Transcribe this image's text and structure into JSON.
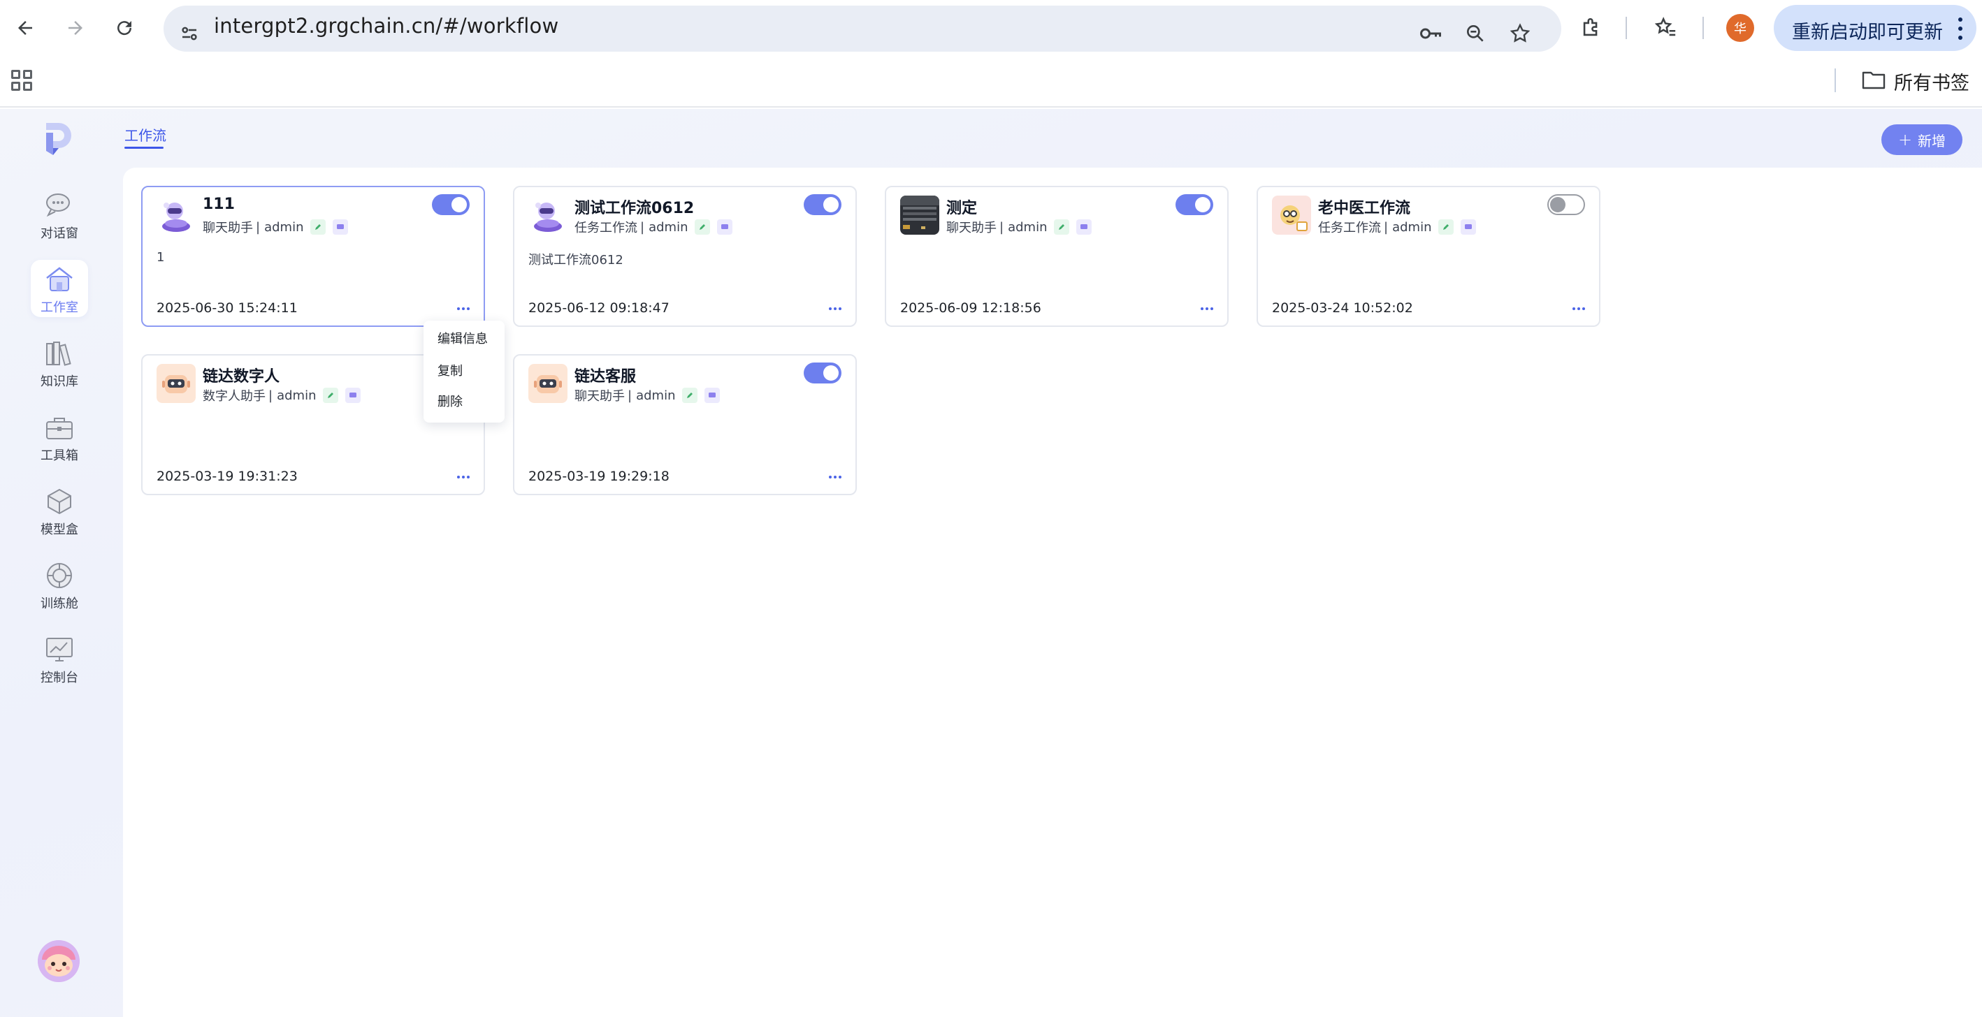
{
  "browser": {
    "url": "intergpt2.grgchain.cn/#/workflow",
    "profile_initial": "华",
    "update_button_label": "重新启动即可更新",
    "bookmarks_label": "所有书签"
  },
  "sidebar": {
    "items": [
      {
        "label": "对话窗",
        "icon": "chat-bubbles-icon"
      },
      {
        "label": "工作室",
        "icon": "house-icon",
        "active": true
      },
      {
        "label": "知识库",
        "icon": "books-icon"
      },
      {
        "label": "工具箱",
        "icon": "toolbox-icon"
      },
      {
        "label": "模型盒",
        "icon": "cube-icon"
      },
      {
        "label": "训练舱",
        "icon": "capsule-icon"
      },
      {
        "label": "控制台",
        "icon": "monitor-chart-icon"
      }
    ]
  },
  "tabs": {
    "workflow_label": "工作流"
  },
  "add_button_label": "新增",
  "cards": [
    {
      "title": "111",
      "type": "聊天助手",
      "owner": "admin",
      "description": "1",
      "date": "2025-06-30 15:24:11",
      "enabled": true,
      "avatar": "purple-bot-icon"
    },
    {
      "title": "测试工作流0612",
      "type": "任务工作流",
      "owner": "admin",
      "description": "测试工作流0612",
      "date": "2025-06-12 09:18:47",
      "enabled": true,
      "avatar": "purple-bot-icon"
    },
    {
      "title": "测定",
      "type": "聊天助手",
      "owner": "admin",
      "description": "",
      "date": "2025-06-09 12:18:56",
      "enabled": true,
      "avatar": "photo-thumbnail"
    },
    {
      "title": "老中医工作流",
      "type": "任务工作流",
      "owner": "admin",
      "description": "",
      "date": "2025-03-24 10:52:02",
      "enabled": false,
      "avatar": "doctor-icon"
    },
    {
      "title": "链达数字人",
      "type": "数字人助手",
      "owner": "admin",
      "description": "",
      "date": "2025-03-19 19:31:23",
      "enabled": null,
      "avatar": "robot-face-icon"
    },
    {
      "title": "链达客服",
      "type": "聊天助手",
      "owner": "admin",
      "description": "",
      "date": "2025-03-19 19:29:18",
      "enabled": true,
      "avatar": "robot-face-icon"
    }
  ],
  "context_menu": {
    "edit_label": "编辑信息",
    "copy_label": "复制",
    "delete_label": "删除"
  },
  "colors": {
    "accent": "#6d7fee",
    "tab_active": "#3d56e8",
    "add_button": "#7282f0"
  }
}
